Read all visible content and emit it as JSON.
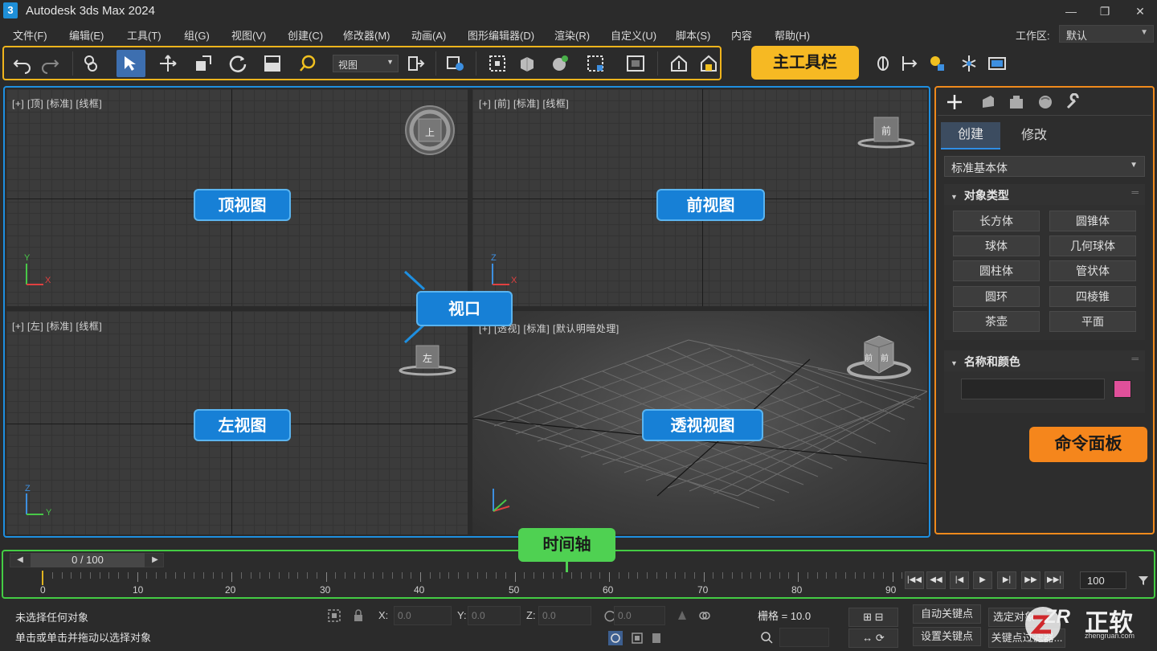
{
  "window": {
    "logo_text": "3",
    "title": "Autodesk 3ds Max 2024",
    "minimize": "—",
    "restore": "❐",
    "close": "✕"
  },
  "menu": {
    "items": [
      "文件(F)",
      "编辑(E)",
      "工具(T)",
      "组(G)",
      "视图(V)",
      "创建(C)",
      "修改器(M)",
      "动画(A)",
      "图形编辑器(D)",
      "渲染(R)",
      "自定义(U)",
      "脚本(S)",
      "内容",
      "帮助(H)"
    ],
    "workspace_label": "工作区:",
    "workspace_value": "默认"
  },
  "toolbar": {
    "view_dropdown": "视图",
    "callout": "主工具栏"
  },
  "viewports": {
    "top": {
      "label": "[+] [顶] [标准] [线框]",
      "callout": "顶视图",
      "cube_face": "上",
      "axis_a": "Y",
      "axis_b": "X"
    },
    "front": {
      "label": "[+] [前] [标准] [线框]",
      "callout": "前视图",
      "cube_face": "前",
      "axis_a": "Z",
      "axis_b": "X"
    },
    "left": {
      "label": "[+] [左] [标准] [线框]",
      "callout": "左视图",
      "cube_face": "左",
      "axis_a": "Z",
      "axis_b": "Y"
    },
    "perspective": {
      "label": "[+] [透视] [标准] [默认明暗处理]",
      "callout": "透视视图",
      "cube_face_a": "前",
      "cube_face_b": "前"
    },
    "callout": "视口"
  },
  "command_panel": {
    "tab_create": "创建",
    "tab_modify": "修改",
    "category": "标准基本体",
    "rollout_object_type": "对象类型",
    "objects": [
      "长方体",
      "圆锥体",
      "球体",
      "几何球体",
      "圆柱体",
      "管状体",
      "圆环",
      "四棱锥",
      "茶壶",
      "平面"
    ],
    "rollout_name_color": "名称和颜色",
    "swatch_color": "#e0509a",
    "callout": "命令面板"
  },
  "timeline": {
    "slider_value": "0 / 100",
    "callout": "时间轴",
    "ruler_labels": [
      "0",
      "10",
      "20",
      "30",
      "40",
      "50",
      "60",
      "70",
      "80",
      "90"
    ],
    "frame_value": "100",
    "partial_a": "00",
    "partial_b": "00"
  },
  "status": {
    "line1": "未选择任何对象",
    "line2": "单击或单击并拖动以选择对象",
    "x_label": "X:",
    "y_label": "Y:",
    "z_label": "Z:",
    "x_value": "0.0",
    "y_value": "0.0",
    "z_value": "0.0",
    "r_value": "0.0",
    "grid": "栅格 = 10.0",
    "auto_key": "自动关键点",
    "set_key": "设置关键点",
    "selected": "选定对象",
    "key_filters": "关键点过滤器..."
  },
  "watermark": {
    "mark": "ZR",
    "name": "正软",
    "url": "zhengruan.com"
  },
  "colors": {
    "toolbar_callout": "#f6b923",
    "viewport_callout": "#1780d6",
    "command_callout": "#f5861c",
    "timeline_callout": "#4fd152"
  }
}
